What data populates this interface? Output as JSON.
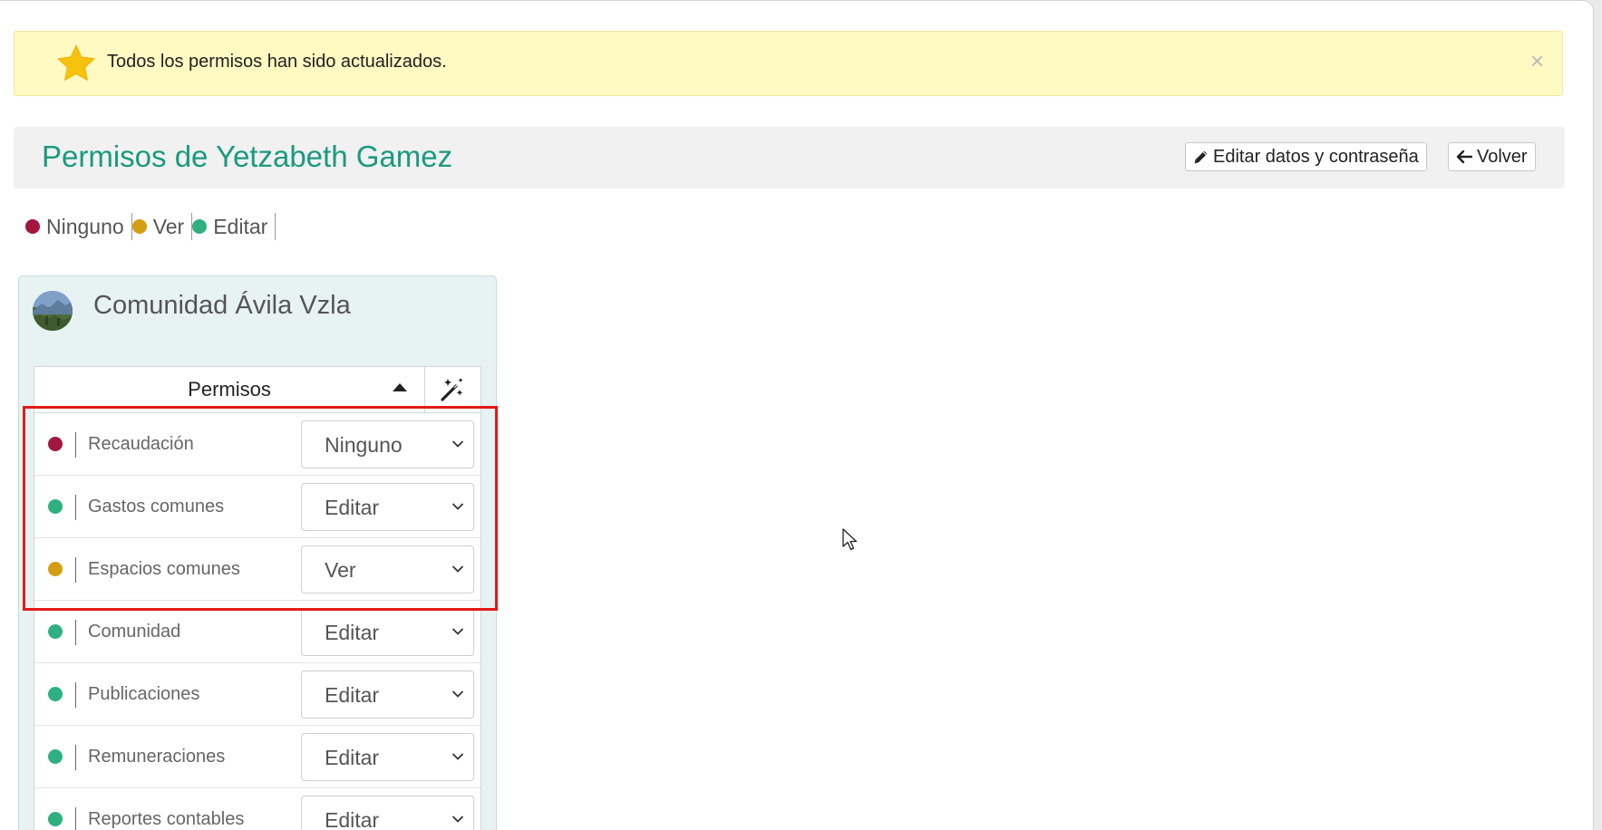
{
  "alert": {
    "message": "Todos los permisos han sido actualizados.",
    "close": "×"
  },
  "header": {
    "title": "Permisos de Yetzabeth Gamez",
    "edit_button": "Editar datos y contraseña",
    "back_button": "Volver"
  },
  "legend": [
    {
      "label": "Ninguno",
      "color": "#a3173f"
    },
    {
      "label": "Ver",
      "color": "#d39e12"
    },
    {
      "label": "Editar",
      "color": "#2fb083"
    }
  ],
  "community": {
    "name": "Comunidad Ávila Vzla"
  },
  "permissions": {
    "header": "Permisos",
    "rows": [
      {
        "name": "Recaudación",
        "value": "Ninguno",
        "color": "#a3173f"
      },
      {
        "name": "Gastos comunes",
        "value": "Editar",
        "color": "#2fb083"
      },
      {
        "name": "Espacios comunes",
        "value": "Ver",
        "color": "#d39e12"
      },
      {
        "name": "Comunidad",
        "value": "Editar",
        "color": "#2fb083"
      },
      {
        "name": "Publicaciones",
        "value": "Editar",
        "color": "#2fb083"
      },
      {
        "name": "Remuneraciones",
        "value": "Editar",
        "color": "#2fb083"
      },
      {
        "name": "Reportes contables",
        "value": "Editar",
        "color": "#2fb083"
      }
    ]
  },
  "colors": {
    "accent": "#1a9a80",
    "alert_bg": "#fff9c2",
    "highlight": "#e41a1a"
  }
}
